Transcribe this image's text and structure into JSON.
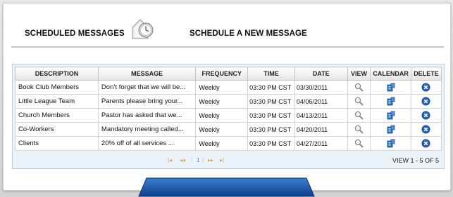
{
  "header": {
    "scheduled_label": "SCHEDULED MESSAGES",
    "new_label": "SCHEDULE A NEW MESSAGE",
    "clock_icon": "clock-icon"
  },
  "table": {
    "columns": [
      "DESCRIPTION",
      "MESSAGE",
      "FREQUENCY",
      "TIME",
      "DATE",
      "VIEW",
      "CALENDAR",
      "DELETE"
    ],
    "rows": [
      {
        "description": "Book Club Members",
        "message": "Don’t forget that we will be...",
        "frequency": "Weekly",
        "time": "03:30 PM CST",
        "date": "03/30/2011"
      },
      {
        "description": "Little League Team",
        "message": "Parents please bring your...",
        "frequency": "Weekly",
        "time": "03:30 PM CST",
        "date": "04/06/2011"
      },
      {
        "description": "Church Members",
        "message": "Pastor has asked that we...",
        "frequency": "Weekly",
        "time": "03:30 PM CST",
        "date": "04/13/2011"
      },
      {
        "description": "Co-Workers",
        "message": "Mandatory meeting called...",
        "frequency": "Weekly",
        "time": "03:30 PM CST",
        "date": "04/20/2011"
      },
      {
        "description": "Clients",
        "message": "20% off of all services ...",
        "frequency": "Weekly",
        "time": "03:30 PM CST",
        "date": "04/27/2011"
      }
    ],
    "icons": {
      "view": "magnifier-icon",
      "calendar": "calendar-icon",
      "delete": "delete-icon"
    }
  },
  "pager": {
    "first": "|◂",
    "prev": "◂◂",
    "page": "1",
    "next": "▸▸",
    "last": "▸|",
    "view_count": "VIEW 1 - 5 OF 5"
  },
  "colors": {
    "accent_blue": "#1f5fb0",
    "delete_blue": "#1a4f9a",
    "pager_disabled": "#d8a24a",
    "grid_border": "#b9d0e6"
  }
}
